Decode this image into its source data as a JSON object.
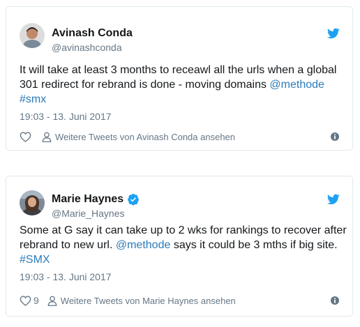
{
  "colors": {
    "border": "#e1e8ed",
    "text": "#14171a",
    "muted": "#657786",
    "link": "#2b7bb9",
    "twitter_blue": "#1da1f2"
  },
  "tweets": [
    {
      "author": {
        "name": "Avinash Conda",
        "handle": "@avinashconda",
        "verified": false
      },
      "text_parts": {
        "body": "It will take at least 3 months to receawl all the urls when a global 301 redirect for rebrand is done - moving domains ",
        "mention": "@methode",
        "hashtag": "#smx"
      },
      "timestamp": "19:03 - 13. Juni 2017",
      "likes": "",
      "more_tweets_label": "Weitere Tweets von Avinash Conda ansehen",
      "icons": [
        "twitter-bird-icon",
        "heart-icon",
        "person-icon",
        "info-icon"
      ]
    },
    {
      "author": {
        "name": "Marie Haynes",
        "handle": "@Marie_Haynes",
        "verified": true
      },
      "text_parts": {
        "body": "Some at G say it can take up to 2 wks for rankings to recover after rebrand to new url. ",
        "mention": "@methode",
        "middle": " says it could be 3 mths if big site. ",
        "hashtag": "#SMX"
      },
      "timestamp": "19:03 - 13. Juni 2017",
      "likes": "9",
      "more_tweets_label": "Weitere Tweets von Marie Haynes ansehen",
      "icons": [
        "twitter-bird-icon",
        "verified-badge-icon",
        "heart-icon",
        "person-icon",
        "info-icon"
      ]
    }
  ]
}
